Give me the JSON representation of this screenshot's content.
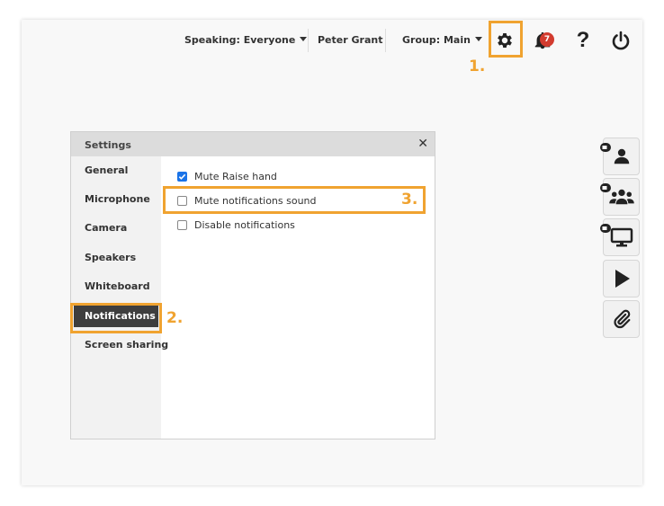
{
  "topbar": {
    "speaking": "Speaking: Everyone",
    "user": "Peter Grant",
    "group": "Group: Main",
    "notification_count": "7"
  },
  "annotations": {
    "step1": "1.",
    "step2": "2.",
    "step3": "3.",
    "highlight_color": "#f0a330"
  },
  "settings_dialog": {
    "title": "Settings",
    "close": "✕",
    "sidebar": [
      {
        "label": "General"
      },
      {
        "label": "Microphone"
      },
      {
        "label": "Camera"
      },
      {
        "label": "Speakers"
      },
      {
        "label": "Whiteboard"
      },
      {
        "label": "Notifications",
        "active": true
      },
      {
        "label": "Screen sharing"
      }
    ],
    "options": [
      {
        "label": "Mute Raise hand",
        "checked": true
      },
      {
        "label": "Mute notifications sound",
        "checked": false
      },
      {
        "label": "Disable notifications",
        "checked": false
      }
    ]
  },
  "right_rail": [
    "user-camera-icon",
    "group-camera-icon",
    "screen-share-icon",
    "play-icon",
    "paperclip-icon"
  ],
  "colors": {
    "accent": "#f0a330",
    "badge": "#d23b2f",
    "checkbox": "#1a73e8",
    "active_item": "#3e3e3e"
  }
}
